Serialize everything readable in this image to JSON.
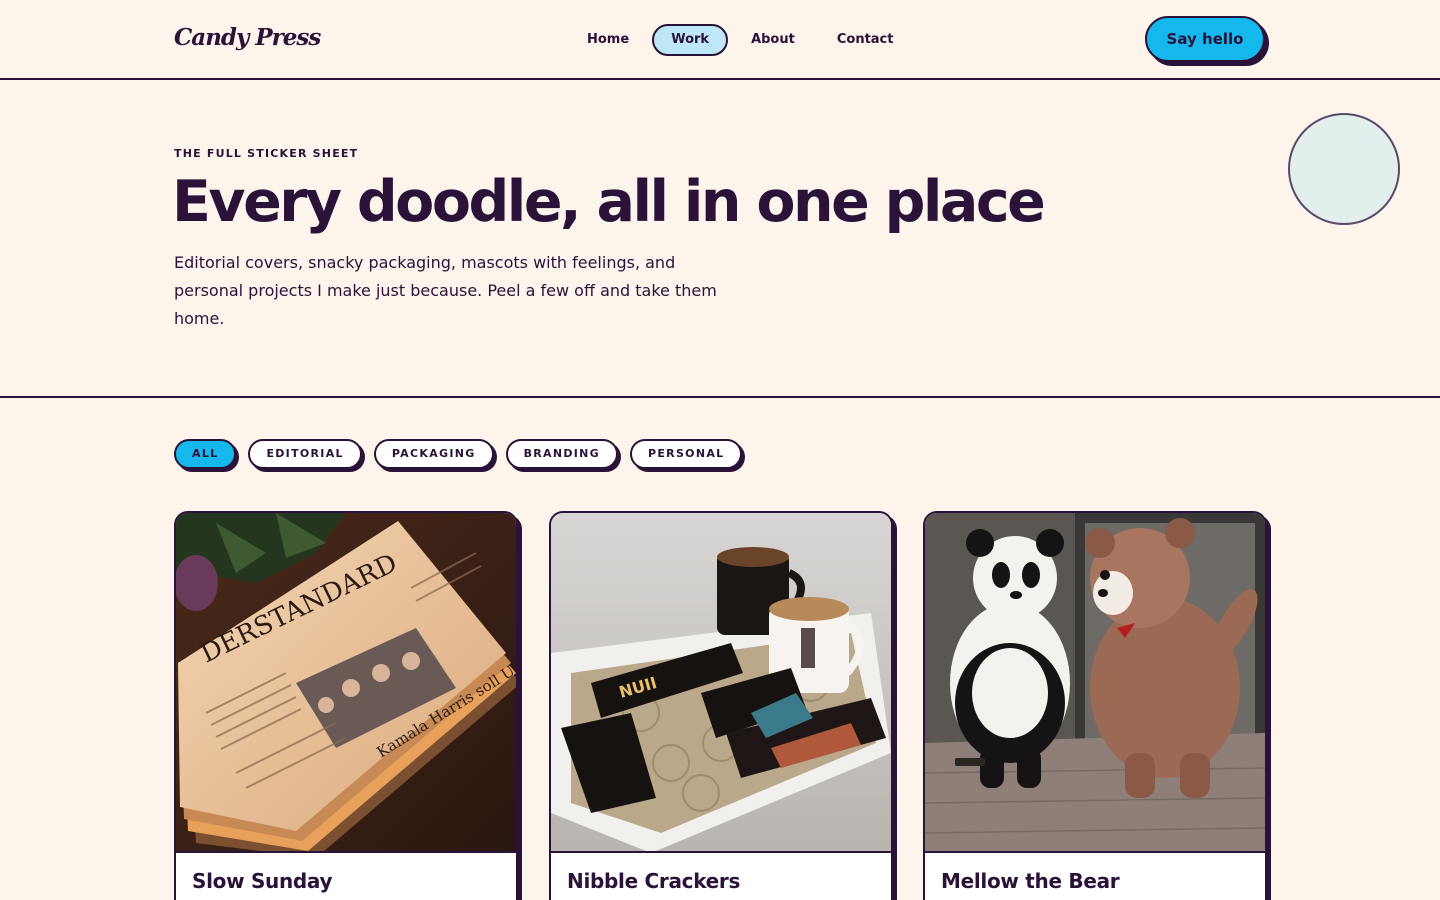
{
  "header": {
    "logo": "Candy Press",
    "nav": [
      {
        "label": "Home",
        "active": false
      },
      {
        "label": "Work",
        "active": true
      },
      {
        "label": "About",
        "active": false
      },
      {
        "label": "Contact",
        "active": false
      }
    ],
    "cta_label": "Say hello"
  },
  "hero": {
    "eyebrow": "THE FULL STICKER SHEET",
    "title": "Every doodle, all in one place",
    "description": "Editorial covers, snacky packaging, mascots with feelings, and personal projects I make just because. Peel a few off and take them home."
  },
  "filters": [
    {
      "label": "ALL",
      "active": true
    },
    {
      "label": "EDITORIAL",
      "active": false
    },
    {
      "label": "PACKAGING",
      "active": false
    },
    {
      "label": "BRANDING",
      "active": false
    },
    {
      "label": "PERSONAL",
      "active": false
    }
  ],
  "cards": [
    {
      "title": "Slow Sunday",
      "image": {
        "masthead": "DERSTANDARD",
        "headline": "Kamala Harris soll US-Wahl"
      }
    },
    {
      "title": "Nibble Crackers",
      "image": {
        "brand": "NUII"
      }
    },
    {
      "title": "Mellow the Bear",
      "image": {}
    }
  ],
  "colors": {
    "background": "#fdf5ec",
    "ink": "#2a1238",
    "accent": "#14b8ec",
    "nav_active": "#bfe8f6",
    "circle": "#e2efec"
  }
}
